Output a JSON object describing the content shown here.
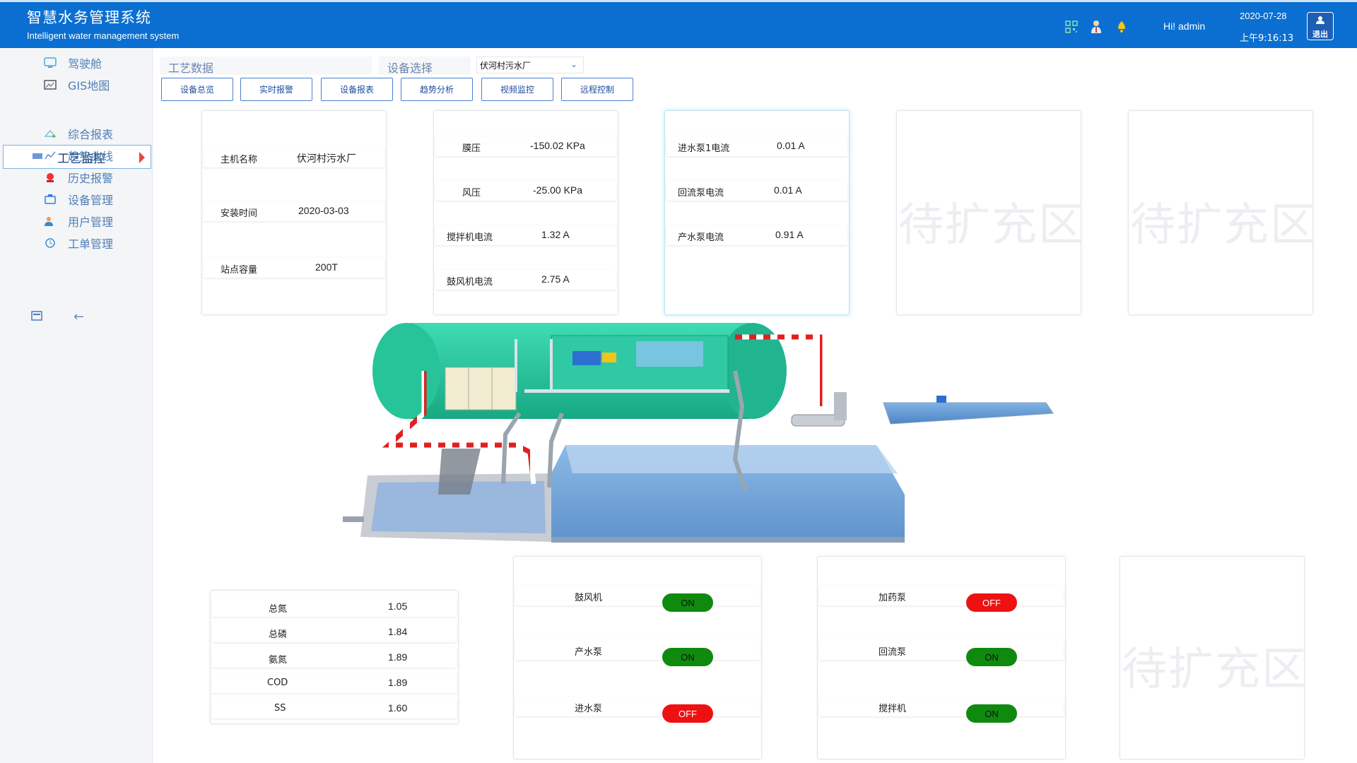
{
  "header": {
    "title": "智慧水务管理系统",
    "subtitle": "Intelligent water management system",
    "greeting": "Hi!  admin",
    "date": "2020-07-28",
    "time": "上午9:16:13",
    "logout": "退出",
    "icons": [
      "qr-code-icon",
      "user-icon",
      "bell-icon",
      "logout-icon"
    ]
  },
  "sidebar": {
    "items": [
      {
        "label": "驾驶舱",
        "icon": "dashboard-icon"
      },
      {
        "label": "GIS地图",
        "icon": "map-icon"
      },
      {
        "label": "工艺监控",
        "icon": "monitor-icon",
        "active": true
      },
      {
        "label": "综合报表",
        "icon": "report-icon"
      },
      {
        "label": "趋势曲线",
        "icon": "trend-icon"
      },
      {
        "label": "历史报警",
        "icon": "alarm-icon"
      },
      {
        "label": "设备管理",
        "icon": "device-icon"
      },
      {
        "label": "用户管理",
        "icon": "users-icon"
      },
      {
        "label": "工单管理",
        "icon": "workorder-icon"
      }
    ],
    "collapse_arrow": "←"
  },
  "toolbar": {
    "process_data_label": "工艺数据",
    "device_select_label": "设备选择",
    "device_selected": "伏河村污水厂",
    "buttons": [
      "设备总览",
      "实时报警",
      "设备报表",
      "趋势分析",
      "视频监控",
      "远程控制"
    ]
  },
  "info_card": {
    "rows": [
      {
        "label": "主机名称",
        "value": "伏河村污水厂"
      },
      {
        "label": "安装时间",
        "value": "2020-03-03"
      },
      {
        "label": "站点容量",
        "value": "200T"
      }
    ]
  },
  "pressure_card": {
    "rows": [
      {
        "label": "膜压",
        "value": "-150.02 KPa"
      },
      {
        "label": "风压",
        "value": "-25.00 KPa"
      },
      {
        "label": "搅拌机电流",
        "value": "1.32 A"
      },
      {
        "label": "鼓风机电流",
        "value": "2.75 A"
      }
    ]
  },
  "pump_card": {
    "rows": [
      {
        "label": "进水泵1电流",
        "value": "0.01 A"
      },
      {
        "label": "回流泵电流",
        "value": "0.01 A"
      },
      {
        "label": "产水泵电流",
        "value": "0.91 A"
      }
    ]
  },
  "placeholders": {
    "text": "待扩充区"
  },
  "quality_card": {
    "rows": [
      {
        "label": "总氮",
        "value": "1.05"
      },
      {
        "label": "总磷",
        "value": "1.84"
      },
      {
        "label": "氨氮",
        "value": "1.89"
      },
      {
        "label": "COD",
        "value": "1.89"
      },
      {
        "label": "SS",
        "value": "1.60"
      }
    ]
  },
  "status_left": {
    "rows": [
      {
        "label": "鼓风机",
        "status": "ON"
      },
      {
        "label": "产水泵",
        "status": "ON"
      },
      {
        "label": "进水泵",
        "status": "OFF"
      }
    ]
  },
  "status_right": {
    "rows": [
      {
        "label": "加药泵",
        "status": "OFF"
      },
      {
        "label": "回流泵",
        "status": "ON"
      },
      {
        "label": "搅拌机",
        "status": "ON"
      }
    ]
  },
  "colors": {
    "header_bg": "#0a6fd1",
    "on": "#0f8a0f",
    "off": "#ee1111",
    "tank_green": "#2ec9a0",
    "water_blue": "#5f9bd6"
  }
}
